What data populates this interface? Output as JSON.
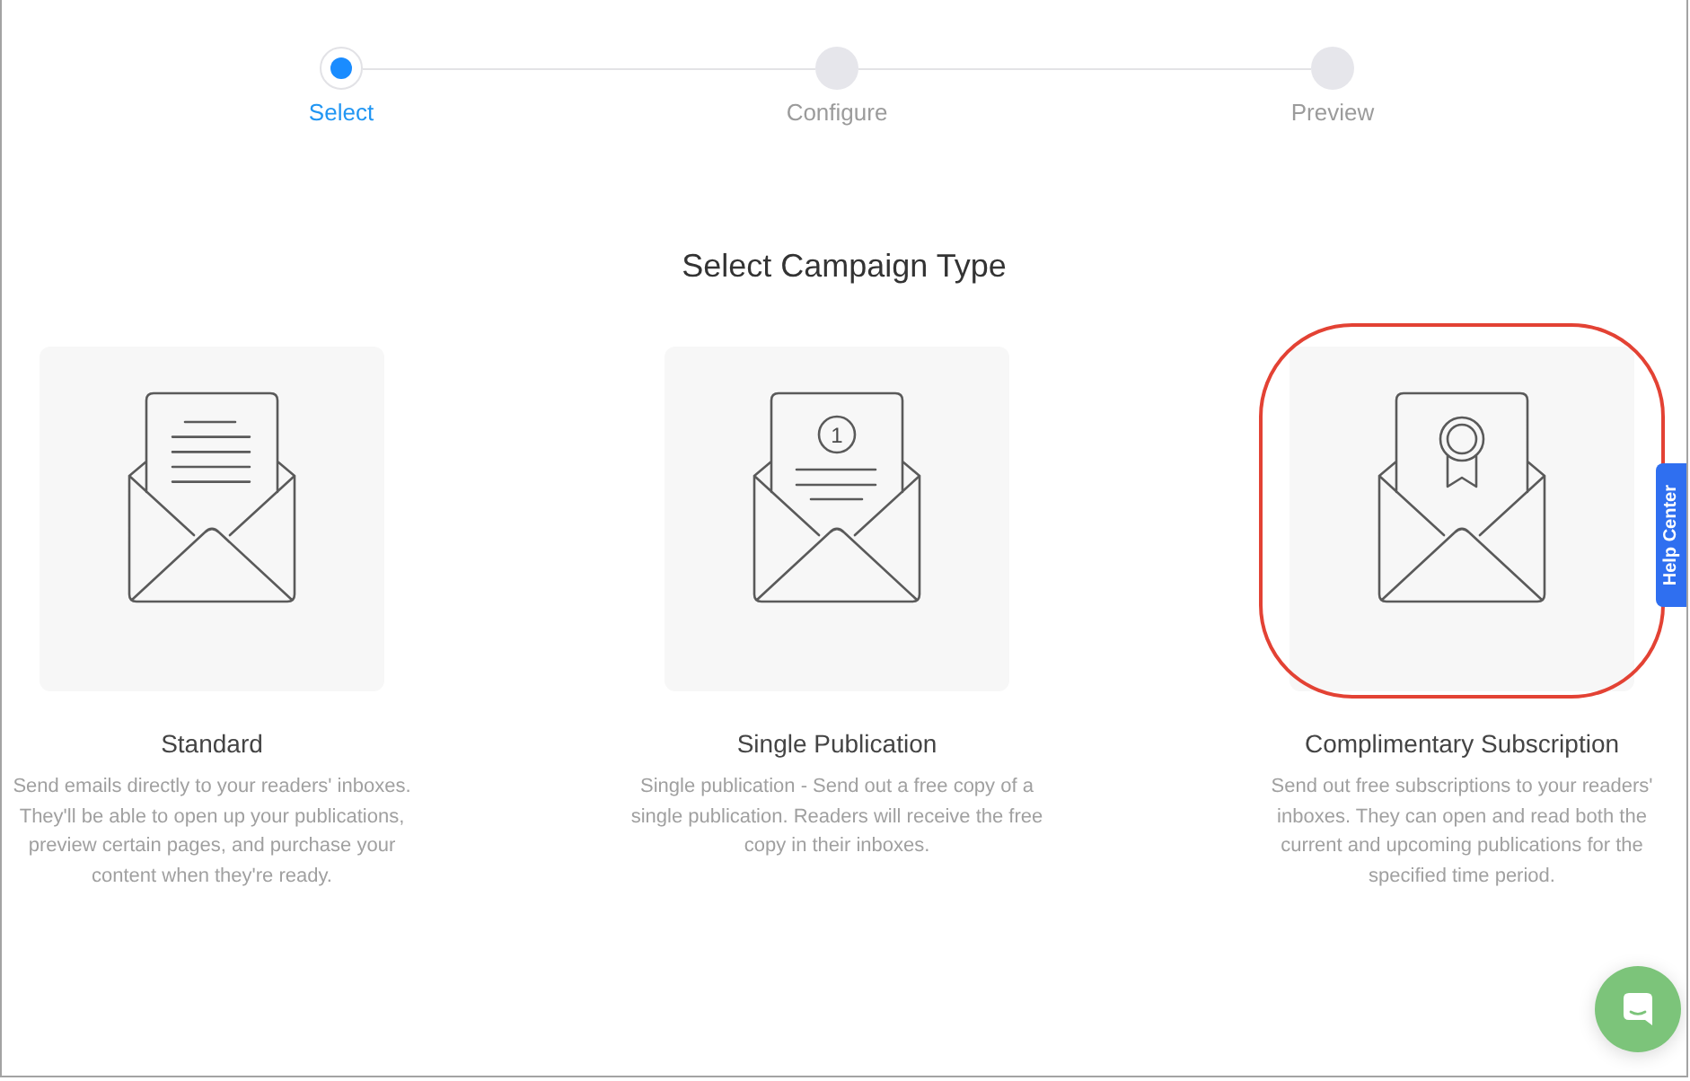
{
  "steps": [
    {
      "label": "Select",
      "selected": true
    },
    {
      "label": "Configure",
      "selected": false
    },
    {
      "label": "Preview",
      "selected": false
    }
  ],
  "heading": "Select Campaign Type",
  "campaign_types": [
    {
      "kind": "standard",
      "title": "Standard",
      "description": "Send emails directly to your readers' inboxes. They'll be able to open up your publications, preview certain pages, and purchase your content when they're ready.",
      "highlighted": false
    },
    {
      "kind": "single",
      "icon_number": "1",
      "title": "Single Publication",
      "description": "Single publication - Send out a free copy of a single publication. Readers will receive the free copy in their inboxes.",
      "highlighted": false
    },
    {
      "kind": "subscription",
      "title": "Complimentary Subscription",
      "description": "Send out free subscriptions to your readers' inboxes. They can open and read both the current and upcoming publications for the specified time period.",
      "highlighted": true
    }
  ],
  "help_tab": {
    "label": "Help Center"
  }
}
